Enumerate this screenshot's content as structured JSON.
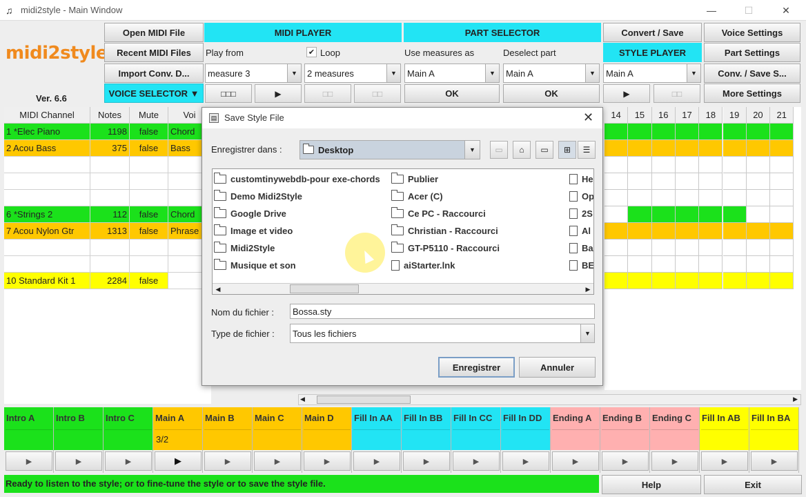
{
  "window": {
    "title": "midi2style - Main Window",
    "minimize": "—",
    "maximize": "☐",
    "close": "✕"
  },
  "logo": {
    "text": "midi2style",
    "version": "Ver. 6.6"
  },
  "left_buttons": {
    "open_midi": "Open MIDI File",
    "recent_midi": "Recent MIDI Files",
    "import_conv": "Import Conv. D...",
    "voice_selector": "VOICE SELECTOR ▼"
  },
  "midi_player": {
    "header": "MIDI PLAYER",
    "play_from_label": "Play from",
    "loop_label": "Loop",
    "loop_checked": "✔",
    "play_from_value": "measure 3",
    "loop_value": "2 measures",
    "btn_stop": "□□□",
    "btn_play": "▶",
    "btn_a": "□□",
    "btn_b": "□□"
  },
  "part_selector": {
    "header": "PART SELECTOR",
    "use_measures_label": "Use measures as",
    "deselect_label": "Deselect part",
    "use_measures_value": "Main A",
    "deselect_value": "Main A",
    "ok1": "OK",
    "ok2": "OK"
  },
  "style_player": {
    "convert_save": "Convert / Save",
    "header": "STYLE PLAYER",
    "value": "Main A",
    "play": "▶",
    "pause": "□□"
  },
  "right_buttons": {
    "voice_settings": "Voice Settings",
    "part_settings": "Part Settings",
    "conv_save": "Conv. / Save S...",
    "more_settings": "More Settings"
  },
  "table": {
    "headers": [
      "MIDI Channel",
      "Notes",
      "Mute",
      "Voi"
    ],
    "rows": [
      {
        "channel": "1 *Elec Piano",
        "notes": "1198",
        "mute": "false",
        "voice": "Chord",
        "color": "#1be11b"
      },
      {
        "channel": "2 Acou Bass",
        "notes": "375",
        "mute": "false",
        "voice": "Bass",
        "color": "#ffc800"
      },
      {
        "channel": "",
        "notes": "",
        "mute": "",
        "voice": "",
        "color": "#ffffff"
      },
      {
        "channel": "",
        "notes": "",
        "mute": "",
        "voice": "",
        "color": "#ffffff"
      },
      {
        "channel": "",
        "notes": "",
        "mute": "",
        "voice": "",
        "color": "#ffffff"
      },
      {
        "channel": "6 *Strings 2",
        "notes": "112",
        "mute": "false",
        "voice": "Chord",
        "color": "#1be11b"
      },
      {
        "channel": "7 Acou Nylon Gtr",
        "notes": "1313",
        "mute": "false",
        "voice": "Phrase",
        "color": "#ffc800"
      },
      {
        "channel": "",
        "notes": "",
        "mute": "",
        "voice": "",
        "color": "#ffffff"
      },
      {
        "channel": "",
        "notes": "",
        "mute": "",
        "voice": "",
        "color": "#ffffff"
      },
      {
        "channel": "10 Standard Kit 1",
        "notes": "2284",
        "mute": "false",
        "voice": "",
        "color": "#ffff00"
      }
    ]
  },
  "measure_grid": {
    "columns": [
      "14",
      "15",
      "16",
      "17",
      "18",
      "19",
      "20",
      "21"
    ]
  },
  "dialog": {
    "title": "Save Style File",
    "close": "✕",
    "save_in_label": "Enregistrer dans :",
    "save_in_value": "Desktop",
    "files_col1": [
      "customtinywebdb-pour exe-chords",
      "Demo Midi2Style",
      "Google Drive",
      "Image et video",
      "Midi2Style",
      "Musique et son"
    ],
    "files_col2": [
      "Publier",
      "Acer (C)",
      "Ce PC - Raccourci",
      "Christian - Raccourci",
      "GT-P5110 - Raccourci",
      "aiStarter.lnk"
    ],
    "files_col3": [
      "He",
      "Op",
      "2S",
      "Al",
      "Ba",
      "BE"
    ],
    "filename_label": "Nom du fichier :",
    "filename_value": "Bossa.sty",
    "filetype_label": "Type de fichier :",
    "filetype_value": "Tous les fichiers",
    "save_button": "Enregistrer",
    "cancel_button": "Annuler"
  },
  "parts": [
    {
      "name": "Intro A",
      "value": "",
      "color": "#1be11b"
    },
    {
      "name": "Intro B",
      "value": "",
      "color": "#1be11b"
    },
    {
      "name": "Intro C",
      "value": "",
      "color": "#1be11b"
    },
    {
      "name": "Main A",
      "value": "3/2",
      "color": "#ffc800"
    },
    {
      "name": "Main B",
      "value": "",
      "color": "#ffc800"
    },
    {
      "name": "Main C",
      "value": "",
      "color": "#ffc800"
    },
    {
      "name": "Main D",
      "value": "",
      "color": "#ffc800"
    },
    {
      "name": "Fill In AA",
      "value": "",
      "color": "#22e4f4"
    },
    {
      "name": "Fill In BB",
      "value": "",
      "color": "#22e4f4"
    },
    {
      "name": "Fill In CC",
      "value": "",
      "color": "#22e4f4"
    },
    {
      "name": "Fill In DD",
      "value": "",
      "color": "#22e4f4"
    },
    {
      "name": "Ending A",
      "value": "",
      "color": "#ffb0b0"
    },
    {
      "name": "Ending B",
      "value": "",
      "color": "#ffb0b0"
    },
    {
      "name": "Ending C",
      "value": "",
      "color": "#ffb0b0"
    },
    {
      "name": "Fill In AB",
      "value": "",
      "color": "#ffff00"
    },
    {
      "name": "Fill In BA",
      "value": "",
      "color": "#ffff00"
    }
  ],
  "part_play_symbol": "▶",
  "status": {
    "text": "Ready to listen to the style; or to fine-tune the style or to save the style file."
  },
  "bottom_buttons": {
    "help": "Help",
    "exit": "Exit"
  }
}
